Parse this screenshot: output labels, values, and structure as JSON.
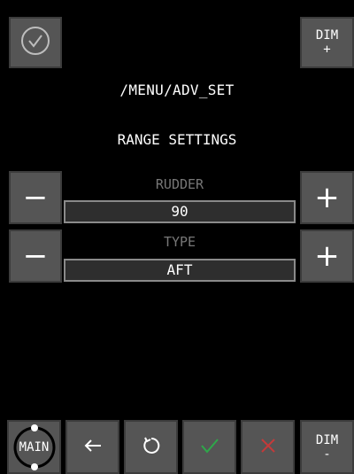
{
  "header": {
    "confirm_icon": "check-circle-icon",
    "dim_plus_label_top": "DIM",
    "dim_plus_label_bottom": "+"
  },
  "path": "/MENU/ADV_SET",
  "title": "RANGE SETTINGS",
  "rows": [
    {
      "label": "RUDDER",
      "value": "90",
      "minus": "−",
      "plus": "+"
    },
    {
      "label": "TYPE",
      "value": "AFT",
      "minus": "−",
      "plus": "+"
    }
  ],
  "footer": {
    "main_label": "MAIN",
    "back_icon": "arrow-left-icon",
    "reset_icon": "rotate-icon",
    "accept_icon": "check-icon",
    "cancel_icon": "x-icon",
    "dim_minus_label_top": "DIM",
    "dim_minus_label_bottom": "-"
  },
  "colors": {
    "accept": "#2ea84a",
    "cancel": "#c43a3a",
    "button_bg": "#555555",
    "field_bg": "#2e2e2e"
  }
}
